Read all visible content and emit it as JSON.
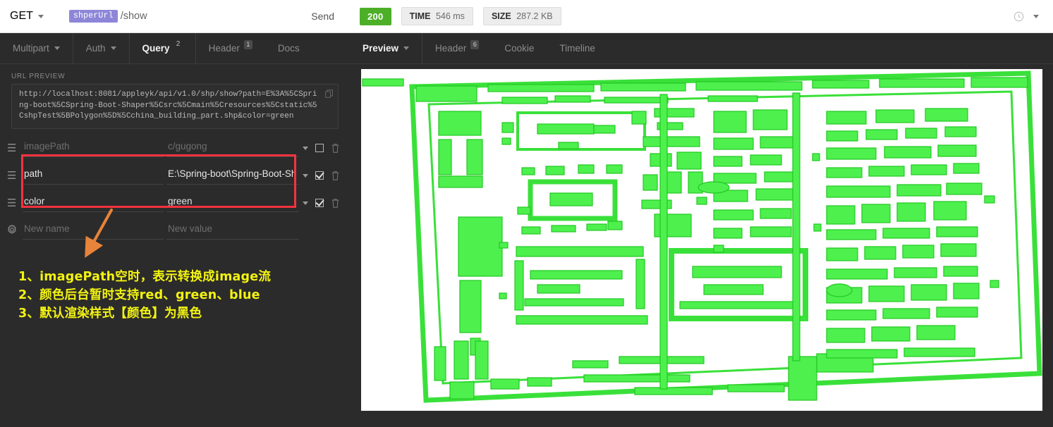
{
  "request": {
    "method": "GET",
    "url_chip": "shperUrl",
    "url_path": "/show",
    "send_label": "Send"
  },
  "request_tabs": [
    {
      "label": "Multipart",
      "badge": "",
      "dropdown": true,
      "active": false
    },
    {
      "label": "Auth",
      "badge": "",
      "dropdown": true,
      "active": false
    },
    {
      "label": "Query",
      "badge": "2",
      "dropdown": false,
      "active": true
    },
    {
      "label": "Header",
      "badge": "1",
      "dropdown": false,
      "active": false
    },
    {
      "label": "Docs",
      "badge": "",
      "dropdown": false,
      "active": false
    }
  ],
  "url_preview": {
    "label": "URL PREVIEW",
    "text": "http://localhost:8081/appleyk/api/v1.0/shp/show?path=E%3A%5CSpring-boot%5CSpring-Boot-Shaper%5Csrc%5Cmain%5Cresources%5Cstatic%5CshpTest%5BPolygon%5D%5Cchina_building_part.shp&color=green"
  },
  "params": {
    "rows": [
      {
        "name": "",
        "name_placeholder": "imagePath",
        "value": "",
        "value_placeholder": "c/gugong",
        "checked": false,
        "handle": "drag-handle"
      },
      {
        "name": "path",
        "name_placeholder": "",
        "value": "E:\\Spring-boot\\Spring-Boot-Sh",
        "value_placeholder": "",
        "checked": true,
        "handle": "drag-handle"
      },
      {
        "name": "color",
        "name_placeholder": "",
        "value": "green",
        "value_placeholder": "",
        "checked": true,
        "handle": "drag-handle"
      }
    ],
    "new_row": {
      "name_placeholder": "New name",
      "value_placeholder": "New value"
    }
  },
  "annotations": {
    "highlight_color": "#f5333f",
    "arrow_color": "#e8833a",
    "note_color": "#f3f312",
    "notes": [
      "1、imagePath空时，表示转换成image流",
      "2、颜色后台暂时支持red、green、blue",
      "3、默认渲染样式【颜色】为黑色"
    ]
  },
  "response": {
    "status_code": "200",
    "status_color": "#4caf27",
    "time_key": "TIME",
    "time_value": "546 ms",
    "size_key": "SIZE",
    "size_value": "287.2 KB"
  },
  "response_tabs": [
    {
      "label": "Preview",
      "badge": "",
      "dropdown": true,
      "active": true
    },
    {
      "label": "Header",
      "badge": "6",
      "dropdown": false,
      "active": false
    },
    {
      "label": "Cookie",
      "badge": "",
      "dropdown": false,
      "active": false
    },
    {
      "label": "Timeline",
      "badge": "",
      "dropdown": false,
      "active": false
    }
  ],
  "preview_image": {
    "description": "china_building_part.shp polygon rendering of the Forbidden City, green fill on white",
    "fill_color": "#4ef04e",
    "stroke_color": "#22c722",
    "background": "#ffffff"
  }
}
